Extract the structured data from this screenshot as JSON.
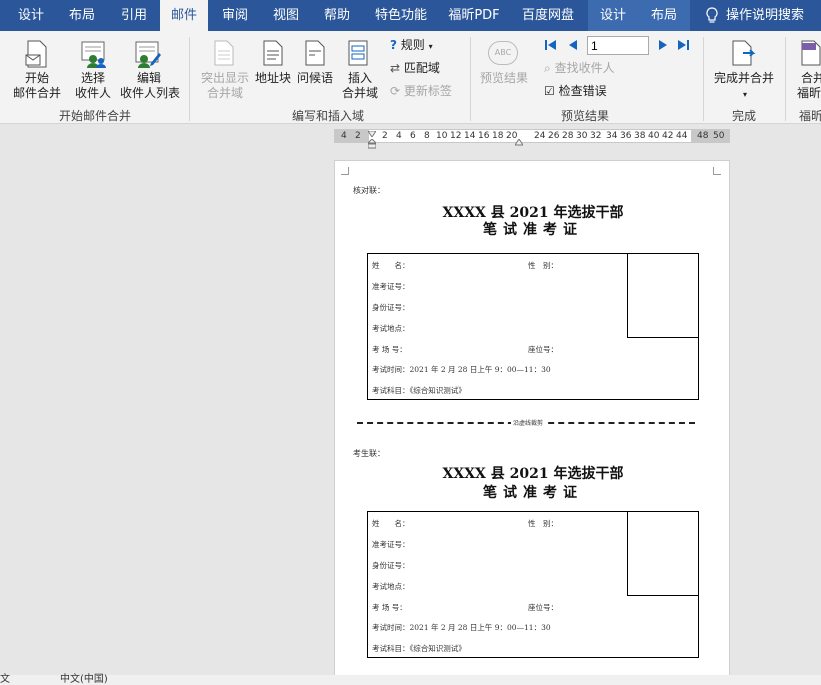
{
  "tabs": [
    "设计",
    "布局",
    "引用",
    "邮件",
    "审阅",
    "视图",
    "帮助",
    "特色功能",
    "福昕PDF",
    "百度网盘",
    "设计",
    "布局"
  ],
  "search_label": "操作说明搜索",
  "ribbon": {
    "start_merge": {
      "btn1": [
        "开始",
        "邮件合并"
      ],
      "btn2": [
        "选择",
        "收件人"
      ],
      "btn3": [
        "编辑",
        "收件人列表"
      ],
      "group": "开始邮件合并"
    },
    "write_insert": {
      "highlight": [
        "突出显示",
        "合并域"
      ],
      "address": "地址块",
      "greeting": "问候语",
      "insert": [
        "插入",
        "合并域"
      ],
      "rules": "规则",
      "match": "匹配域",
      "update": "更新标签",
      "group": "编写和插入域"
    },
    "preview": {
      "preview_results": "预览结果",
      "record_value": "1",
      "find": "查找收件人",
      "check": "检查错误",
      "group": "预览结果",
      "abc": "ABC"
    },
    "finish": {
      "finish_merge": "完成并合并",
      "group": "完成",
      "merge_fox": [
        "合并",
        "福昕"
      ],
      "group2": "福昕"
    }
  },
  "ruler_ticks": [
    "4",
    "2",
    "2",
    "4",
    "6",
    "8",
    "10",
    "12",
    "14",
    "16",
    "18",
    "20",
    "24",
    "26",
    "28",
    "30",
    "32",
    "34",
    "36",
    "38",
    "40",
    "42",
    "44",
    "48",
    "50"
  ],
  "doc": {
    "stub_label": "核对联：",
    "exam_label": "考生联：",
    "title": "XXXX 县 2021 年选拔干部",
    "subtitle": "笔试准考证",
    "cut_text": "沿虚线裁剪",
    "fields": {
      "name": "姓　　名：",
      "gender": "性　别：",
      "exam_no": "准考证号：",
      "id_no": "身份证号：",
      "location": "考试地点：",
      "room": "考 场 号：",
      "seat": "座位号：",
      "time": "考试时间：2021 年 2 月 28 日上午 9：00—11：30",
      "subject": "考试科目：《综合知识测试》"
    }
  },
  "status": {
    "lang": "中文(中国)",
    "left": "文"
  }
}
